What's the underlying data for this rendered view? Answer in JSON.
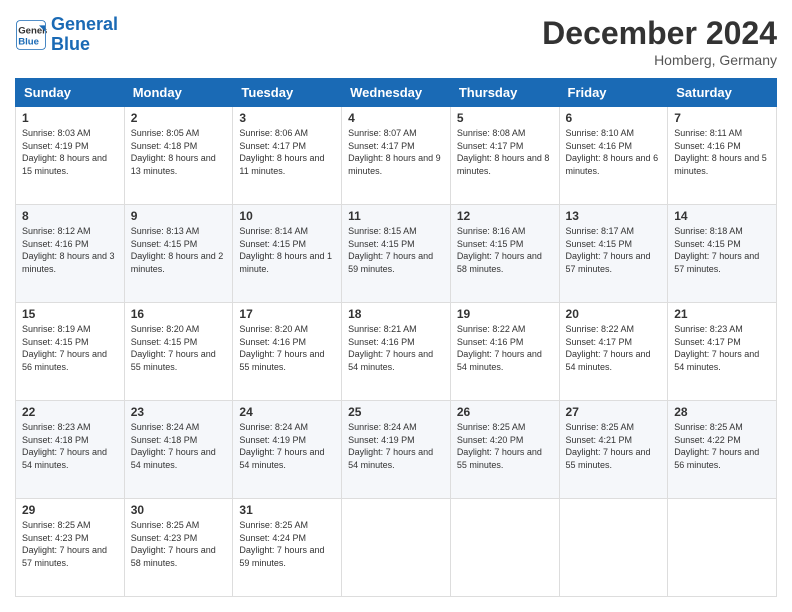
{
  "header": {
    "logo_line1": "General",
    "logo_line2": "Blue",
    "month_title": "December 2024",
    "location": "Homberg, Germany"
  },
  "weekdays": [
    "Sunday",
    "Monday",
    "Tuesday",
    "Wednesday",
    "Thursday",
    "Friday",
    "Saturday"
  ],
  "weeks": [
    [
      {
        "day": "1",
        "sunrise": "Sunrise: 8:03 AM",
        "sunset": "Sunset: 4:19 PM",
        "daylight": "Daylight: 8 hours and 15 minutes."
      },
      {
        "day": "2",
        "sunrise": "Sunrise: 8:05 AM",
        "sunset": "Sunset: 4:18 PM",
        "daylight": "Daylight: 8 hours and 13 minutes."
      },
      {
        "day": "3",
        "sunrise": "Sunrise: 8:06 AM",
        "sunset": "Sunset: 4:17 PM",
        "daylight": "Daylight: 8 hours and 11 minutes."
      },
      {
        "day": "4",
        "sunrise": "Sunrise: 8:07 AM",
        "sunset": "Sunset: 4:17 PM",
        "daylight": "Daylight: 8 hours and 9 minutes."
      },
      {
        "day": "5",
        "sunrise": "Sunrise: 8:08 AM",
        "sunset": "Sunset: 4:17 PM",
        "daylight": "Daylight: 8 hours and 8 minutes."
      },
      {
        "day": "6",
        "sunrise": "Sunrise: 8:10 AM",
        "sunset": "Sunset: 4:16 PM",
        "daylight": "Daylight: 8 hours and 6 minutes."
      },
      {
        "day": "7",
        "sunrise": "Sunrise: 8:11 AM",
        "sunset": "Sunset: 4:16 PM",
        "daylight": "Daylight: 8 hours and 5 minutes."
      }
    ],
    [
      {
        "day": "8",
        "sunrise": "Sunrise: 8:12 AM",
        "sunset": "Sunset: 4:16 PM",
        "daylight": "Daylight: 8 hours and 3 minutes."
      },
      {
        "day": "9",
        "sunrise": "Sunrise: 8:13 AM",
        "sunset": "Sunset: 4:15 PM",
        "daylight": "Daylight: 8 hours and 2 minutes."
      },
      {
        "day": "10",
        "sunrise": "Sunrise: 8:14 AM",
        "sunset": "Sunset: 4:15 PM",
        "daylight": "Daylight: 8 hours and 1 minute."
      },
      {
        "day": "11",
        "sunrise": "Sunrise: 8:15 AM",
        "sunset": "Sunset: 4:15 PM",
        "daylight": "Daylight: 7 hours and 59 minutes."
      },
      {
        "day": "12",
        "sunrise": "Sunrise: 8:16 AM",
        "sunset": "Sunset: 4:15 PM",
        "daylight": "Daylight: 7 hours and 58 minutes."
      },
      {
        "day": "13",
        "sunrise": "Sunrise: 8:17 AM",
        "sunset": "Sunset: 4:15 PM",
        "daylight": "Daylight: 7 hours and 57 minutes."
      },
      {
        "day": "14",
        "sunrise": "Sunrise: 8:18 AM",
        "sunset": "Sunset: 4:15 PM",
        "daylight": "Daylight: 7 hours and 57 minutes."
      }
    ],
    [
      {
        "day": "15",
        "sunrise": "Sunrise: 8:19 AM",
        "sunset": "Sunset: 4:15 PM",
        "daylight": "Daylight: 7 hours and 56 minutes."
      },
      {
        "day": "16",
        "sunrise": "Sunrise: 8:20 AM",
        "sunset": "Sunset: 4:15 PM",
        "daylight": "Daylight: 7 hours and 55 minutes."
      },
      {
        "day": "17",
        "sunrise": "Sunrise: 8:20 AM",
        "sunset": "Sunset: 4:16 PM",
        "daylight": "Daylight: 7 hours and 55 minutes."
      },
      {
        "day": "18",
        "sunrise": "Sunrise: 8:21 AM",
        "sunset": "Sunset: 4:16 PM",
        "daylight": "Daylight: 7 hours and 54 minutes."
      },
      {
        "day": "19",
        "sunrise": "Sunrise: 8:22 AM",
        "sunset": "Sunset: 4:16 PM",
        "daylight": "Daylight: 7 hours and 54 minutes."
      },
      {
        "day": "20",
        "sunrise": "Sunrise: 8:22 AM",
        "sunset": "Sunset: 4:17 PM",
        "daylight": "Daylight: 7 hours and 54 minutes."
      },
      {
        "day": "21",
        "sunrise": "Sunrise: 8:23 AM",
        "sunset": "Sunset: 4:17 PM",
        "daylight": "Daylight: 7 hours and 54 minutes."
      }
    ],
    [
      {
        "day": "22",
        "sunrise": "Sunrise: 8:23 AM",
        "sunset": "Sunset: 4:18 PM",
        "daylight": "Daylight: 7 hours and 54 minutes."
      },
      {
        "day": "23",
        "sunrise": "Sunrise: 8:24 AM",
        "sunset": "Sunset: 4:18 PM",
        "daylight": "Daylight: 7 hours and 54 minutes."
      },
      {
        "day": "24",
        "sunrise": "Sunrise: 8:24 AM",
        "sunset": "Sunset: 4:19 PM",
        "daylight": "Daylight: 7 hours and 54 minutes."
      },
      {
        "day": "25",
        "sunrise": "Sunrise: 8:24 AM",
        "sunset": "Sunset: 4:19 PM",
        "daylight": "Daylight: 7 hours and 54 minutes."
      },
      {
        "day": "26",
        "sunrise": "Sunrise: 8:25 AM",
        "sunset": "Sunset: 4:20 PM",
        "daylight": "Daylight: 7 hours and 55 minutes."
      },
      {
        "day": "27",
        "sunrise": "Sunrise: 8:25 AM",
        "sunset": "Sunset: 4:21 PM",
        "daylight": "Daylight: 7 hours and 55 minutes."
      },
      {
        "day": "28",
        "sunrise": "Sunrise: 8:25 AM",
        "sunset": "Sunset: 4:22 PM",
        "daylight": "Daylight: 7 hours and 56 minutes."
      }
    ],
    [
      {
        "day": "29",
        "sunrise": "Sunrise: 8:25 AM",
        "sunset": "Sunset: 4:23 PM",
        "daylight": "Daylight: 7 hours and 57 minutes."
      },
      {
        "day": "30",
        "sunrise": "Sunrise: 8:25 AM",
        "sunset": "Sunset: 4:23 PM",
        "daylight": "Daylight: 7 hours and 58 minutes."
      },
      {
        "day": "31",
        "sunrise": "Sunrise: 8:25 AM",
        "sunset": "Sunset: 4:24 PM",
        "daylight": "Daylight: 7 hours and 59 minutes."
      },
      null,
      null,
      null,
      null
    ]
  ]
}
